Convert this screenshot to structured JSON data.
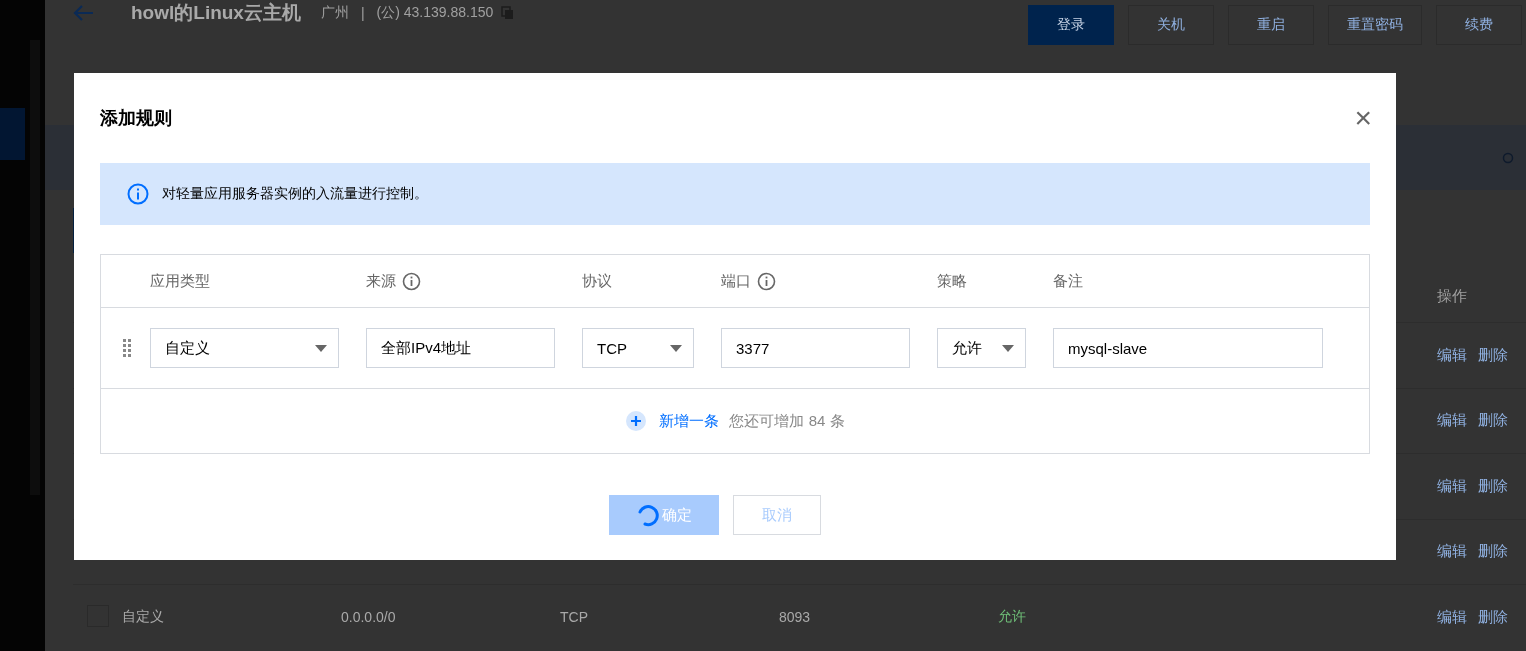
{
  "page": {
    "title": "howl的Linux云主机",
    "region": "广州",
    "separator": "|",
    "ip": "(公) 43.139.88.150",
    "buttons": [
      {
        "label": "登录",
        "primary": true
      },
      {
        "label": "关机",
        "primary": false
      },
      {
        "label": "重启",
        "primary": false
      },
      {
        "label": "重置密码",
        "primary": false
      },
      {
        "label": "续费",
        "primary": false
      }
    ]
  },
  "rules_table": {
    "action_header": "操作",
    "rows": [
      {
        "actions": [
          "编辑",
          "删除"
        ]
      },
      {
        "actions": [
          "编辑",
          "删除"
        ]
      },
      {
        "actions": [
          "编辑",
          "删除"
        ]
      },
      {
        "actions": [
          "编辑",
          "删除"
        ]
      },
      {
        "checked": false,
        "app_type": "自定义",
        "source": "0.0.0.0/0",
        "protocol": "TCP",
        "port": "8093",
        "policy": "允许",
        "actions": [
          "编辑",
          "删除"
        ]
      }
    ]
  },
  "dialog": {
    "title": "添加规则",
    "close": "×",
    "info": "对轻量应用服务器实例的入流量进行控制。",
    "columns": [
      {
        "label": "应用类型",
        "info": false
      },
      {
        "label": "来源",
        "info": true
      },
      {
        "label": "协议",
        "info": false
      },
      {
        "label": "端口",
        "info": true
      },
      {
        "label": "策略",
        "info": false
      },
      {
        "label": "备注",
        "info": false
      }
    ],
    "fields": [
      {
        "kind": "select",
        "value": "自定义"
      },
      {
        "kind": "input",
        "value": "全部IPv4地址"
      },
      {
        "kind": "select",
        "value": "TCP"
      },
      {
        "kind": "input",
        "value": "3377"
      },
      {
        "kind": "select",
        "value": "允许"
      },
      {
        "kind": "input",
        "value": "mysql-slave"
      }
    ],
    "add_label": "新增一条",
    "add_hint": "您还可增加 84 条",
    "confirm": {
      "label": "确定",
      "loading": true
    },
    "cancel": "取消"
  }
}
